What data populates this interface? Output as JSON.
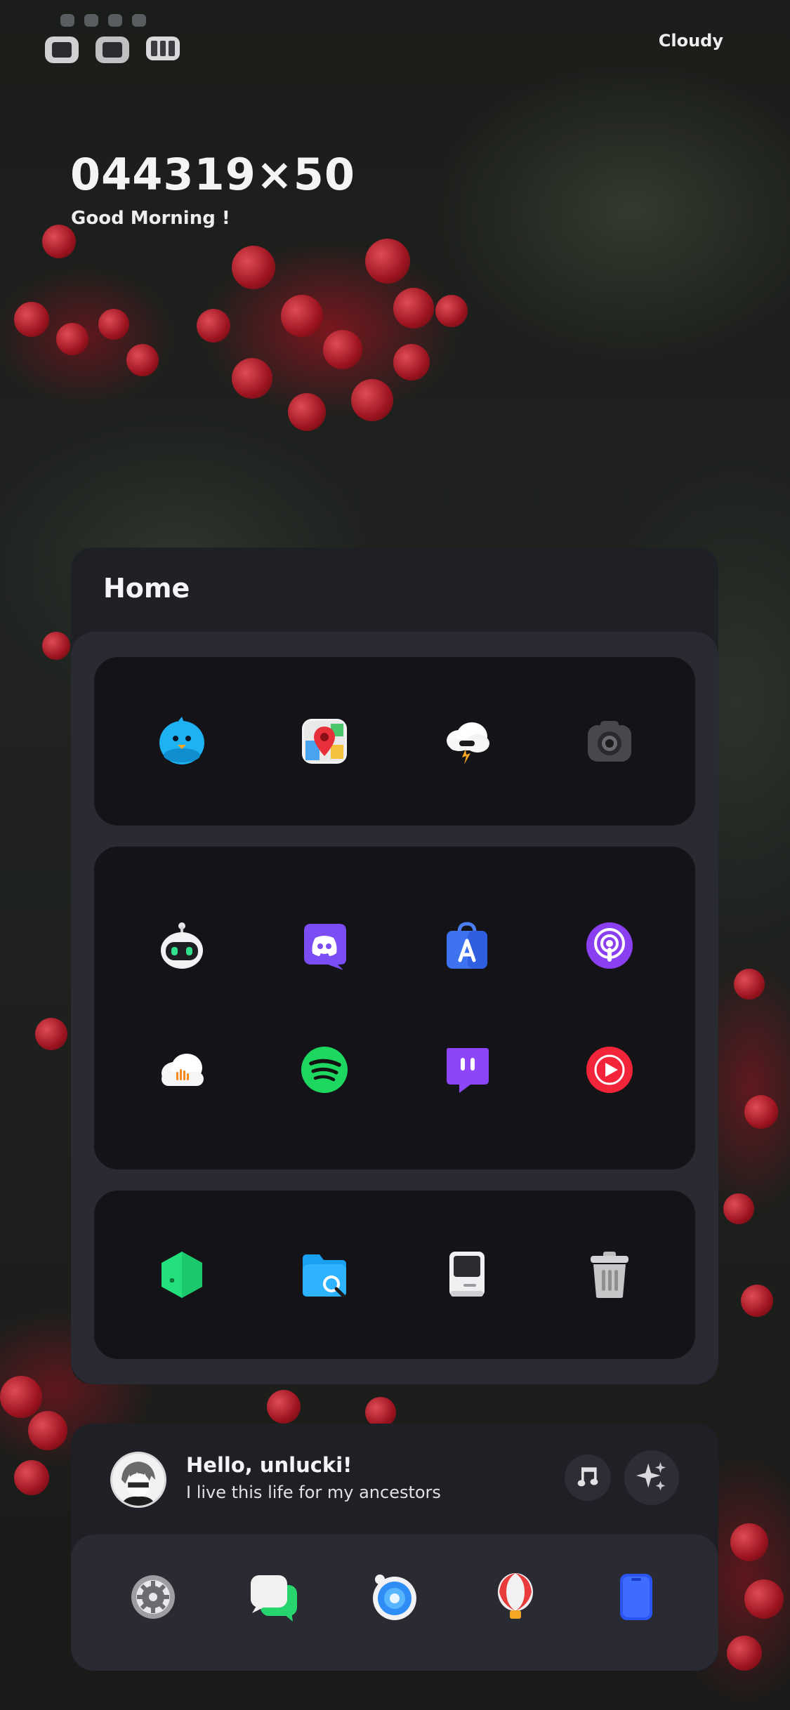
{
  "status_bar": {
    "weather": "Cloudy"
  },
  "clock": {
    "time": "044319×50",
    "greeting": "Good Morning !"
  },
  "home": {
    "title": "Home",
    "groups": [
      [
        "bird-app-icon",
        "maps-app-icon",
        "weather-storm-app-icon",
        "camera-app-icon"
      ],
      [
        "robot-app-icon",
        "discord-app-icon",
        "app-store-app-icon",
        "podcasts-app-icon",
        "soundcloud-app-icon",
        "spotify-app-icon",
        "twitch-app-icon",
        "youtube-music-app-icon"
      ],
      [
        "green-hexagon-app-icon",
        "files-app-icon",
        "retro-computer-app-icon",
        "trash-app-icon"
      ]
    ]
  },
  "profile": {
    "greeting": "Hello, unlucki!",
    "bio": "I live this life for my ancestors",
    "buttons": [
      "music-note-icon",
      "sparkles-icon"
    ]
  },
  "dock": {
    "apps": [
      "settings-icon",
      "messages-icon",
      "browser-icon",
      "balloon-icon",
      "phone-device-icon"
    ]
  }
}
